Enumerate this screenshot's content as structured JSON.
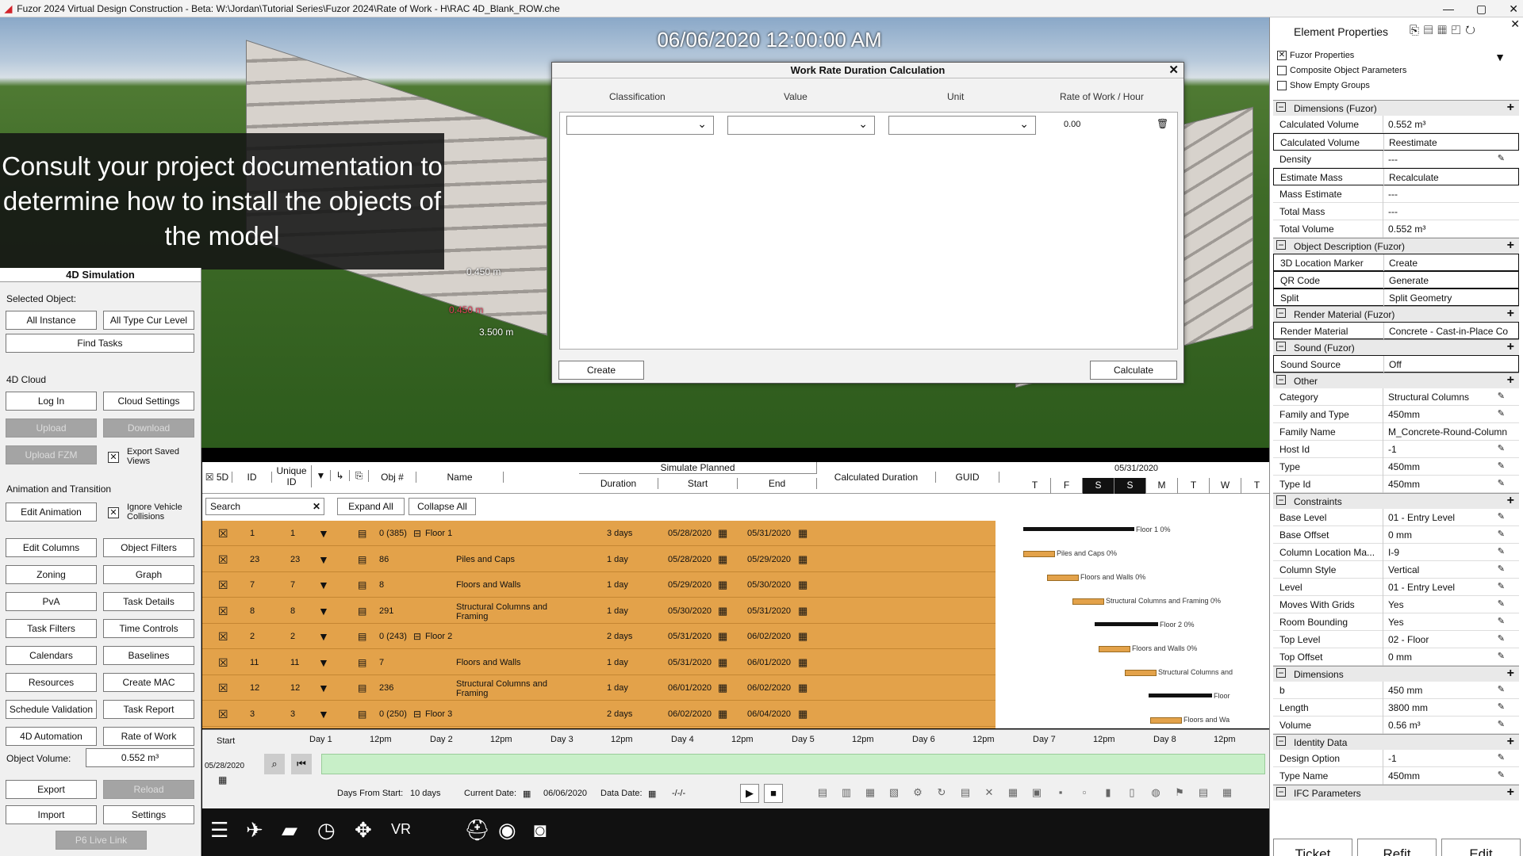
{
  "window": {
    "title": "Fuzor 2024 Virtual Design Construction - Beta: W:\\Jordan\\Tutorial Series\\Fuzor 2024\\Rate of Work - H\\RAC 4D_Blank_ROW.che",
    "minimize": "—",
    "maximize": "▢",
    "close": "✕"
  },
  "viewport": {
    "datetime": "06/06/2020 12:00:00 AM",
    "caption": "Consult your project documentation to determine how to install the objects of the model",
    "dim1": "0.450 m",
    "dim2": "0.450 m",
    "dim3": "3.500 m"
  },
  "dialog": {
    "title": "Work Rate Duration Calculation",
    "close": "✕",
    "headers": [
      "Classification",
      "Value",
      "Unit",
      "Rate of Work / Hour"
    ],
    "rate_value": "0.00",
    "create": "Create",
    "calculate": "Calculate"
  },
  "left": {
    "title": "4D Simulation",
    "selected_object": "Selected Object:",
    "all_instance": "All Instance",
    "all_type": "All Type Cur Level",
    "find_tasks": "Find Tasks",
    "cloud": "4D Cloud",
    "log_in": "Log In",
    "cloud_settings": "Cloud Settings",
    "upload": "Upload",
    "download": "Download",
    "upload_fzm": "Upload FZM",
    "export_saved": "Export Saved Views",
    "anim": "Animation and Transition",
    "edit_animation": "Edit Animation",
    "ignore_vehicle": "Ignore Vehicle Collisions",
    "buttons": [
      "Edit Columns",
      "Object Filters",
      "Zoning",
      "Graph",
      "PvA",
      "Task Details",
      "Task Filters",
      "Time Controls",
      "Calendars",
      "Baselines",
      "Resources",
      "Create MAC",
      "Schedule Validation",
      "Task Report",
      "4D Automation",
      "Rate of Work"
    ],
    "object_volume_label": "Object Volume:",
    "object_volume": "0.552 m³",
    "export": "Export",
    "reload": "Reload",
    "import": "Import",
    "settings": "Settings",
    "p6": "P6 Live Link"
  },
  "grid": {
    "h_5d": "5D",
    "h_id": "ID",
    "h_unique": "Unique ID",
    "h_obj": "Obj #",
    "h_name": "Name",
    "h_sim": "Simulate Planned",
    "h_duration": "Duration",
    "h_start": "Start",
    "h_end": "End",
    "h_calc": "Calculated Duration",
    "h_guid": "GUID",
    "h_date": "05/31/2020",
    "days": [
      "T",
      "F",
      "S",
      "S",
      "M",
      "T",
      "W",
      "T"
    ],
    "search": "Search",
    "expand": "Expand All",
    "collapse": "Collapse All",
    "rows": [
      {
        "id": "1",
        "uid": "1",
        "obj": "0 (385)",
        "name": "Floor 1",
        "group": true,
        "dur": "3 days",
        "start": "05/28/2020",
        "end": "05/31/2020"
      },
      {
        "id": "23",
        "uid": "23",
        "obj": "86",
        "name": "Piles and Caps",
        "group": false,
        "dur": "1 day",
        "start": "05/28/2020",
        "end": "05/29/2020"
      },
      {
        "id": "7",
        "uid": "7",
        "obj": "8",
        "name": "Floors and Walls",
        "group": false,
        "dur": "1 day",
        "start": "05/29/2020",
        "end": "05/30/2020"
      },
      {
        "id": "8",
        "uid": "8",
        "obj": "291",
        "name": "Structural Columns and Framing",
        "group": false,
        "dur": "1 day",
        "start": "05/30/2020",
        "end": "05/31/2020"
      },
      {
        "id": "2",
        "uid": "2",
        "obj": "0 (243)",
        "name": "Floor 2",
        "group": true,
        "dur": "2 days",
        "start": "05/31/2020",
        "end": "06/02/2020"
      },
      {
        "id": "11",
        "uid": "11",
        "obj": "7",
        "name": "Floors and Walls",
        "group": false,
        "dur": "1 day",
        "start": "05/31/2020",
        "end": "06/01/2020"
      },
      {
        "id": "12",
        "uid": "12",
        "obj": "236",
        "name": "Structural Columns and Framing",
        "group": false,
        "dur": "1 day",
        "start": "06/01/2020",
        "end": "06/02/2020"
      },
      {
        "id": "3",
        "uid": "3",
        "obj": "0 (250)",
        "name": "Floor 3",
        "group": true,
        "dur": "2 days",
        "start": "06/02/2020",
        "end": "06/04/2020"
      }
    ],
    "gantt": [
      "Floor 1  0%",
      "Piles and Caps  0%",
      "Floors and Walls  0%",
      "Structural Columns and Framing  0%",
      "Floor 2  0%",
      "Floors and Walls  0%",
      "Structural Columns and",
      "Floor",
      "Floors and Wa"
    ]
  },
  "timeline": {
    "start_label": "Start",
    "start_date": "05/28/2020",
    "days": [
      "Day 1",
      "12pm",
      "Day 2",
      "12pm",
      "Day 3",
      "12pm",
      "Day 4",
      "12pm",
      "Day 5",
      "12pm",
      "Day 6",
      "12pm",
      "Day 7",
      "12pm",
      "Day 8",
      "12pm"
    ],
    "days_from_start_label": "Days From Start:",
    "days_from_start": "10 days",
    "current_date_label": "Current Date:",
    "current_date": "06/06/2020",
    "data_date_label": "Data Date:",
    "data_date": "-/-/-"
  },
  "props": {
    "title": "Element Properties",
    "opt_fuzor": "Fuzor Properties",
    "opt_composite": "Composite Object Parameters",
    "opt_empty": "Show Empty Groups",
    "sections": [
      {
        "t": "Dimensions (Fuzor)",
        "rows": [
          [
            "Calculated Volume",
            "0.552 m³",
            false,
            false
          ],
          [
            "Calculated Volume",
            "Reestimate",
            true,
            false
          ],
          [
            "Density",
            "---",
            false,
            true
          ],
          [
            "Estimate Mass",
            "Recalculate",
            true,
            false
          ],
          [
            "Mass Estimate",
            "---",
            false,
            false
          ],
          [
            "Total Mass",
            "---",
            false,
            false
          ],
          [
            "Total Volume",
            "0.552 m³",
            false,
            false
          ]
        ]
      },
      {
        "t": "Object Description (Fuzor)",
        "rows": [
          [
            "3D Location Marker",
            "Create",
            true,
            false
          ],
          [
            "QR Code",
            "Generate",
            true,
            false
          ],
          [
            "Split",
            "Split Geometry",
            true,
            false
          ]
        ]
      },
      {
        "t": "Render Material (Fuzor)",
        "rows": [
          [
            "Render Material",
            "Concrete - Cast-in-Place Co...",
            true,
            false
          ]
        ]
      },
      {
        "t": "Sound (Fuzor)",
        "rows": [
          [
            "Sound Source",
            "Off",
            true,
            false
          ]
        ]
      },
      {
        "t": "Other",
        "rows": [
          [
            "Category",
            "Structural Columns",
            false,
            true
          ],
          [
            "Family and Type",
            "450mm",
            false,
            true
          ],
          [
            "Family Name",
            "M_Concrete-Round-Column",
            false,
            false
          ],
          [
            "Host Id",
            "-1",
            false,
            true
          ],
          [
            "Type",
            "450mm",
            false,
            true
          ],
          [
            "Type Id",
            "450mm",
            false,
            true
          ]
        ]
      },
      {
        "t": "Constraints",
        "rows": [
          [
            "Base Level",
            "01 - Entry Level",
            false,
            true
          ],
          [
            "Base Offset",
            "0 mm",
            false,
            true
          ],
          [
            "Column Location Ma...",
            "I-9",
            false,
            true
          ],
          [
            "Column Style",
            "Vertical",
            false,
            true
          ],
          [
            "Level",
            "01 - Entry Level",
            false,
            true
          ],
          [
            "Moves With Grids",
            "Yes",
            false,
            true
          ],
          [
            "Room Bounding",
            "Yes",
            false,
            true
          ],
          [
            "Top Level",
            "02 - Floor",
            false,
            true
          ],
          [
            "Top Offset",
            "0 mm",
            false,
            true
          ]
        ]
      },
      {
        "t": "Dimensions",
        "rows": [
          [
            "b",
            "450 mm",
            false,
            true
          ],
          [
            "Length",
            "3800 mm",
            false,
            true
          ],
          [
            "Volume",
            "0.56 m³",
            false,
            true
          ]
        ]
      },
      {
        "t": "Identity Data",
        "rows": [
          [
            "Design Option",
            "-1",
            false,
            true
          ],
          [
            "Type Name",
            "450mm",
            false,
            true
          ]
        ]
      },
      {
        "t": "IFC Parameters",
        "rows": []
      }
    ],
    "ticket": "Ticket",
    "refit": "Refit",
    "edit": "Edit"
  }
}
